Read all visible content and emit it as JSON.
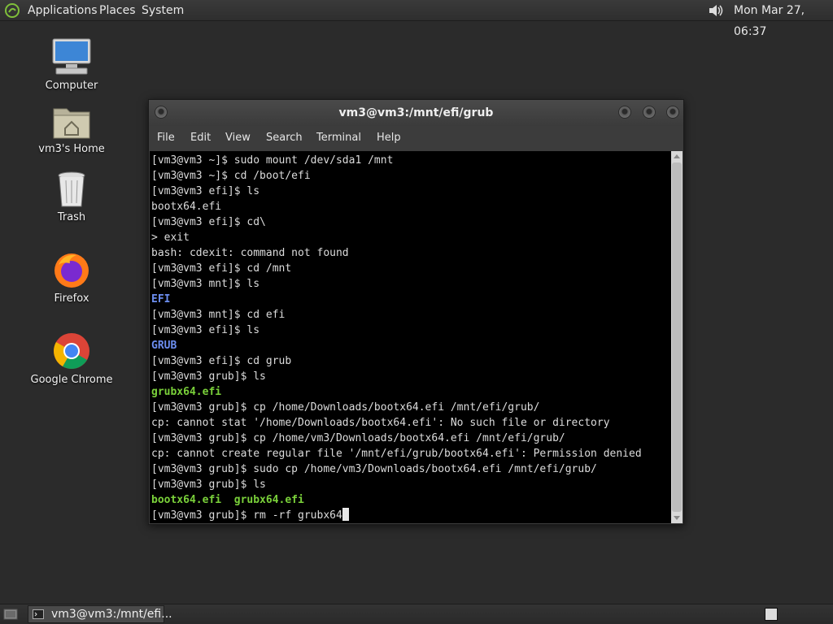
{
  "top_panel": {
    "menus": [
      "Applications",
      "Places",
      "System"
    ],
    "clock": "Mon Mar 27, 06:37"
  },
  "desktop": {
    "icons": [
      {
        "label": "Computer",
        "icon": "computer-icon"
      },
      {
        "label": "vm3's Home",
        "icon": "home-folder-icon"
      },
      {
        "label": "Trash",
        "icon": "trash-icon"
      },
      {
        "label": "Firefox",
        "icon": "firefox-icon"
      },
      {
        "label": "Google Chrome",
        "icon": "chrome-icon"
      }
    ]
  },
  "terminal": {
    "title": "vm3@vm3:/mnt/efi/grub",
    "menu": [
      "File",
      "Edit",
      "View",
      "Search",
      "Terminal",
      "Help"
    ],
    "lines": [
      {
        "text": "[vm3@vm3 ~]$ sudo mount /dev/sda1 /mnt",
        "style": "normal"
      },
      {
        "text": "[vm3@vm3 ~]$ cd /boot/efi",
        "style": "normal"
      },
      {
        "text": "[vm3@vm3 efi]$ ls",
        "style": "normal"
      },
      {
        "text": "bootx64.efi",
        "style": "normal"
      },
      {
        "text": "[vm3@vm3 efi]$ cd\\",
        "style": "normal"
      },
      {
        "text": "> exit",
        "style": "normal"
      },
      {
        "text": "bash: cdexit: command not found",
        "style": "normal"
      },
      {
        "text": "[vm3@vm3 efi]$ cd /mnt",
        "style": "normal"
      },
      {
        "text": "[vm3@vm3 mnt]$ ls",
        "style": "normal"
      },
      {
        "text": "EFI",
        "style": "dir"
      },
      {
        "text": "[vm3@vm3 mnt]$ cd efi",
        "style": "normal"
      },
      {
        "text": "[vm3@vm3 efi]$ ls",
        "style": "normal"
      },
      {
        "text": "GRUB",
        "style": "dir"
      },
      {
        "text": "[vm3@vm3 efi]$ cd grub",
        "style": "normal"
      },
      {
        "text": "[vm3@vm3 grub]$ ls",
        "style": "normal"
      },
      {
        "text": "grubx64.efi",
        "style": "exe"
      },
      {
        "text": "[vm3@vm3 grub]$ cp /home/Downloads/bootx64.efi /mnt/efi/grub/",
        "style": "normal"
      },
      {
        "text": "cp: cannot stat '/home/Downloads/bootx64.efi': No such file or directory",
        "style": "normal"
      },
      {
        "text": "[vm3@vm3 grub]$ cp /home/vm3/Downloads/bootx64.efi /mnt/efi/grub/",
        "style": "normal"
      },
      {
        "text": "cp: cannot create regular file '/mnt/efi/grub/bootx64.efi': Permission denied",
        "style": "normal"
      },
      {
        "text": "[vm3@vm3 grub]$ sudo cp /home/vm3/Downloads/bootx64.efi /mnt/efi/grub/",
        "style": "normal"
      },
      {
        "text": "[vm3@vm3 grub]$ ls",
        "style": "normal"
      },
      {
        "text": "bootx64.efi  grubx64.efi",
        "style": "exe"
      },
      {
        "text": "[vm3@vm3 grub]$ rm -rf grubx64",
        "style": "prompt"
      }
    ]
  },
  "taskbar": {
    "task_label": "vm3@vm3:/mnt/efi..."
  }
}
